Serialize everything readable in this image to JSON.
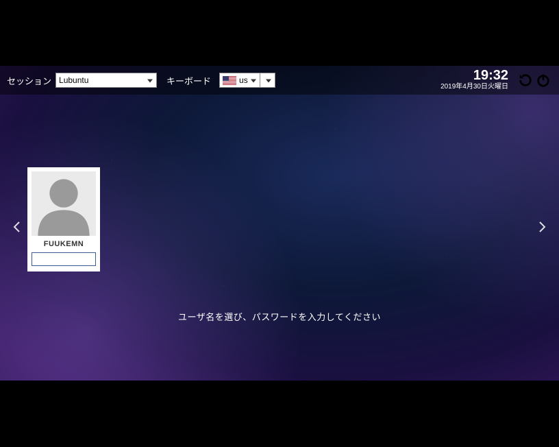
{
  "topbar": {
    "session_label": "セッション",
    "session_value": "Lubuntu",
    "keyboard_label": "キーボード",
    "keyboard_value": "us",
    "keyboard_flag": "us"
  },
  "clock": {
    "time": "19:32",
    "date": "2019年4月30日火曜日"
  },
  "icons": {
    "restart": "restart-icon",
    "shutdown": "shutdown-icon"
  },
  "user": {
    "name": "FUUKEMN",
    "password_value": ""
  },
  "prompt": "ユーザ名を選び、パスワードを入力してください"
}
